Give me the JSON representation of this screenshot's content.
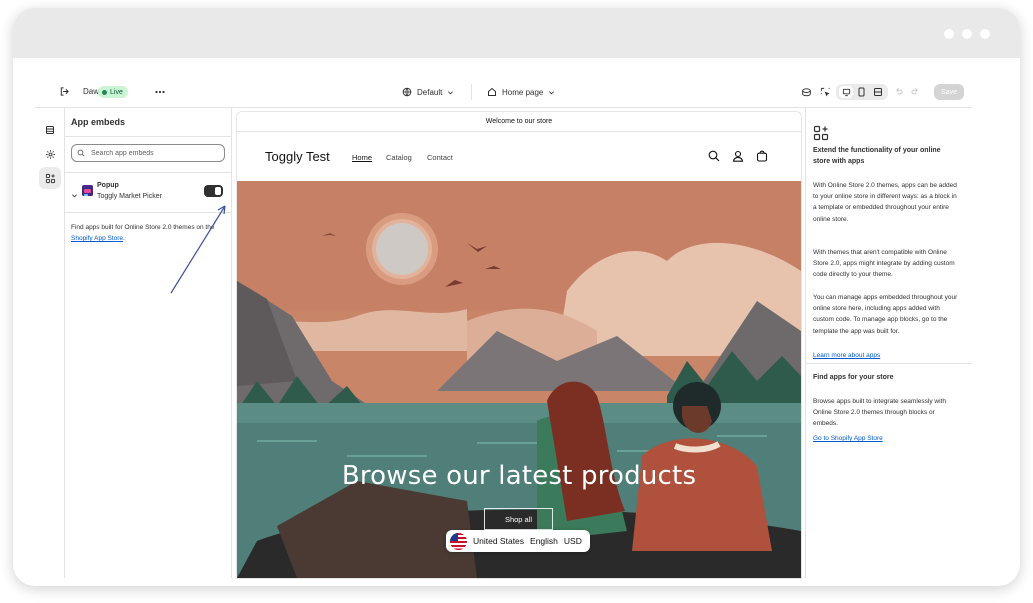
{
  "editor": {
    "theme_name": "Dawn",
    "status_badge": "Live",
    "more_icon": "ellipsis-icon",
    "template_selector": "Default",
    "page_selector": "Home page",
    "save_label": "Save"
  },
  "sidebar": {
    "title": "App embeds",
    "search_placeholder": "Search app embeds",
    "apps": [
      {
        "name": "Popup",
        "app": "Toggly Market Picker",
        "enabled": true
      }
    ],
    "note_before": "Find apps built for Online Store 2.0 themes on the ",
    "note_link": "Shopify App Store",
    "note_after": "."
  },
  "preview": {
    "announcement": "Welcome to our store",
    "store_name": "Toggly Test",
    "nav": [
      "Home",
      "Catalog",
      "Contact"
    ],
    "active_nav": "Home",
    "hero_title": "Browse our latest products",
    "hero_button": "Shop all",
    "locale": {
      "country": "United States",
      "language": "English",
      "currency": "USD"
    }
  },
  "right_panel": {
    "title": "Extend the functionality of your online store with apps",
    "p1": "With Online Store 2.0 themes, apps can be added to your online store in different ways: as a block in a template or embedded throughout your entire online store.",
    "p2": "With themes that aren't compatible with Online Store 2.0, apps might integrate by adding custom code directly to your theme.",
    "p3": "You can manage apps embedded throughout your online store here, including apps added with custom code. To manage app blocks, go to the template the app was built for.",
    "link1": "Learn more about apps",
    "h2": "Find apps for your store",
    "p4": "Browse apps built to integrate seamlessly with Online Store 2.0 themes through blocks or embeds.",
    "link2": "Go to Shopify App Store"
  },
  "colors": {
    "live_badge": "#c9f5d4",
    "link": "#005bd3",
    "annotation_arrow": "#3d4f9e"
  }
}
